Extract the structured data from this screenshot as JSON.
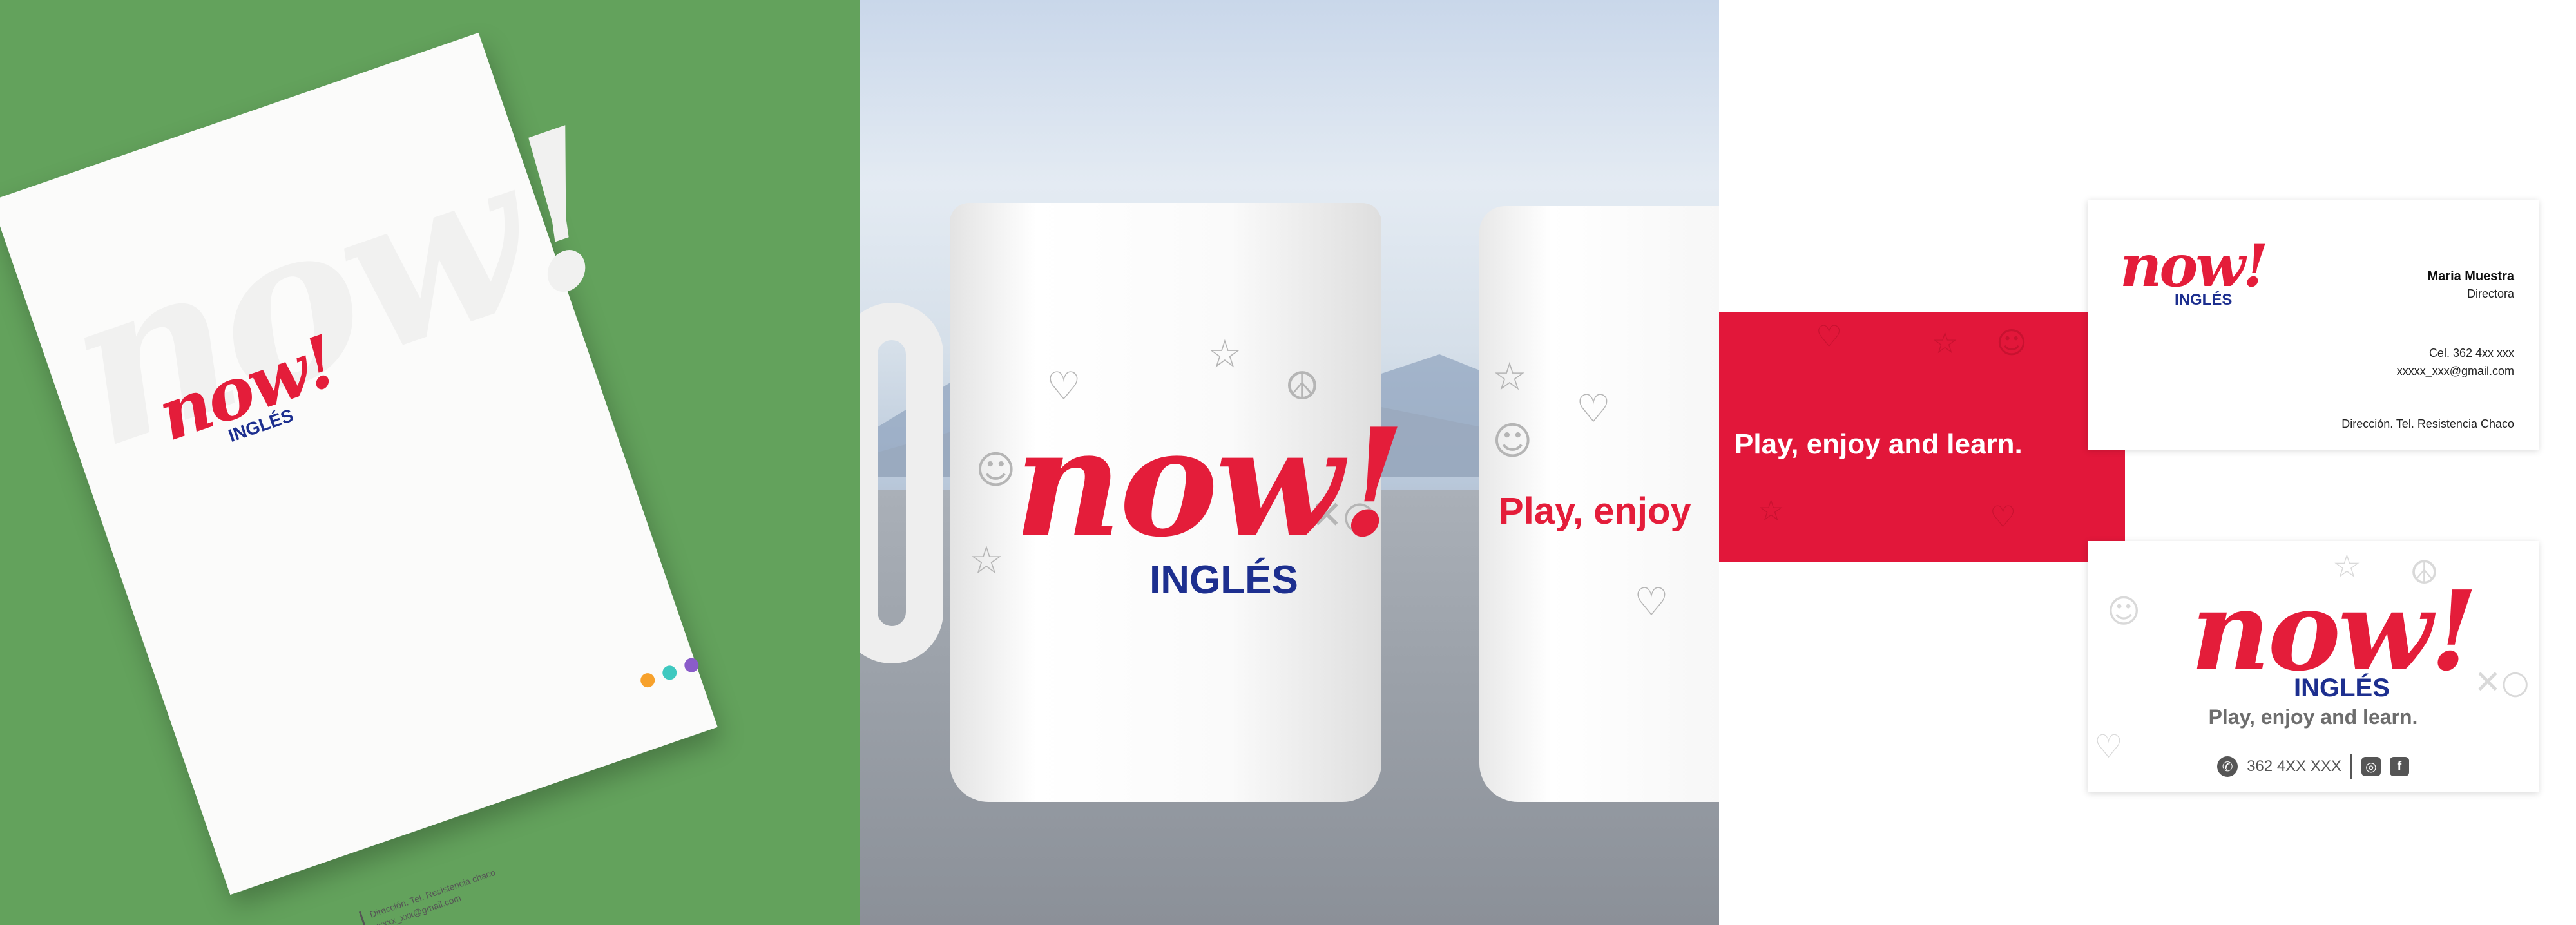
{
  "brand": {
    "logo_word": "now!",
    "logo_sub": "INGLÉS",
    "tagline": "Play, enjoy and learn.",
    "mug_tagline_partial": "Play, enjoy",
    "colors": {
      "red": "#e41d3a",
      "blue": "#1d2f8f",
      "green_bg": "#63a25c"
    }
  },
  "letterhead": {
    "footer_line1": "Dirección. Tel. Resistencia chaco",
    "footer_line2": "xxxxx_xxx@gmail.com",
    "dot_colors": [
      "#f7a12b",
      "#3fc9c0",
      "#8a5cc9"
    ]
  },
  "business_card": {
    "name": "Maria Muestra",
    "role": "Directora",
    "cel": "Cel. 362 4xx xxx",
    "email": "xxxxx_xxx@gmail.com",
    "address": "Dirección. Tel. Resistencia Chaco"
  },
  "card_back": {
    "phone": "362 4XX XXX",
    "icons": [
      "whatsapp-icon",
      "instagram-icon",
      "facebook-icon"
    ]
  }
}
